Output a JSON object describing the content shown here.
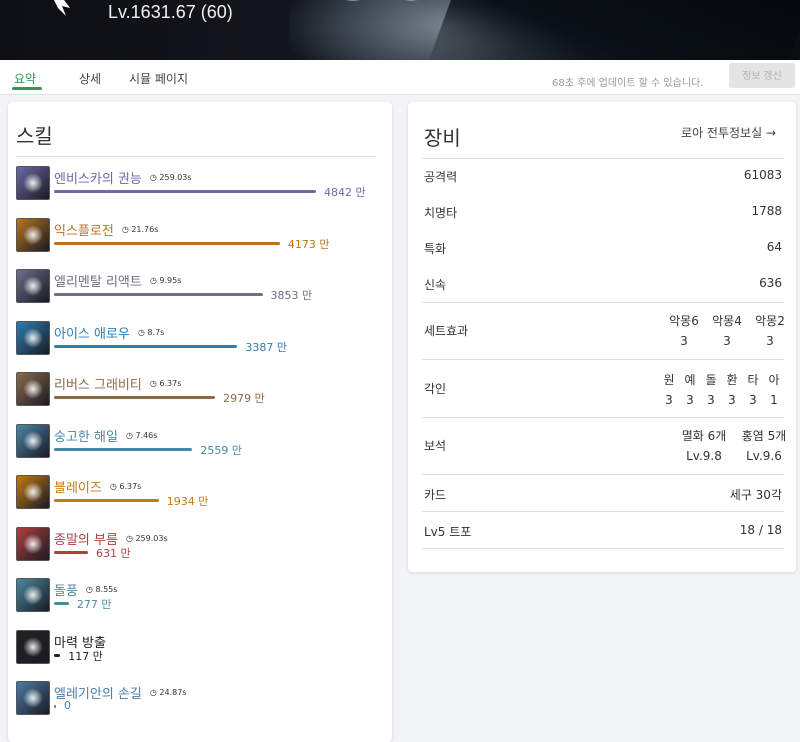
{
  "header": {
    "level_text": "Lv.1631.67 (60)"
  },
  "tabs": [
    {
      "label": "요약",
      "active": true
    },
    {
      "label": "상세",
      "active": false
    },
    {
      "label": "시뮬 페이지",
      "active": false
    }
  ],
  "update_note": "68초 후에 업데이트 할 수 있습니다.",
  "refresh_label": "정보 갱신",
  "skills": {
    "title": "스킬",
    "items": [
      {
        "name": "엔비스카의 권능",
        "cooldown": "259.03s",
        "damage": "4842 만",
        "bar_fraction": 1.0,
        "color": "#6d6aa8",
        "icon": "envisca-authority-icon"
      },
      {
        "name": "익스플로전",
        "cooldown": "21.76s",
        "damage": "4173 만",
        "bar_fraction": 0.862,
        "color": "#b8741c",
        "icon": "explosion-icon"
      },
      {
        "name": "엘리멘탈 리액트",
        "cooldown": "9.95s",
        "damage": "3853 만",
        "bar_fraction": 0.796,
        "color": "#6c6f87",
        "icon": "elemental-react-icon"
      },
      {
        "name": "아이스 애로우",
        "cooldown": "8.7s",
        "damage": "3387 만",
        "bar_fraction": 0.7,
        "color": "#2d7eb2",
        "icon": "ice-arrow-icon"
      },
      {
        "name": "리버스 그래비티",
        "cooldown": "6.37s",
        "damage": "2979 만",
        "bar_fraction": 0.615,
        "color": "#8b6a4a",
        "icon": "reverse-gravity-icon"
      },
      {
        "name": "숭고한 해일",
        "cooldown": "7.46s",
        "damage": "2559 만",
        "bar_fraction": 0.528,
        "color": "#4a86a8",
        "icon": "sublime-wave-icon"
      },
      {
        "name": "블레이즈",
        "cooldown": "6.37s",
        "damage": "1934 만",
        "bar_fraction": 0.4,
        "color": "#c47a10",
        "icon": "blaze-icon"
      },
      {
        "name": "종말의 부름",
        "cooldown": "259.03s",
        "damage": "631 만",
        "bar_fraction": 0.13,
        "color": "#b04040",
        "icon": "call-of-doom-icon"
      },
      {
        "name": "돌풍",
        "cooldown": "8.55s",
        "damage": "277 만",
        "bar_fraction": 0.057,
        "color": "#4a8aa0",
        "icon": "gust-icon"
      },
      {
        "name": "마력 방출",
        "cooldown": "",
        "damage": "117 만",
        "bar_fraction": 0.024,
        "color": "#222222",
        "icon": "mana-release-icon"
      },
      {
        "name": "엘레기안의 손길",
        "cooldown": "24.87s",
        "damage": "0",
        "bar_fraction": 0.0,
        "color": "#4a7ca8",
        "icon": "elegian-touch-icon"
      }
    ]
  },
  "equipment": {
    "title": "장비",
    "link_label": "로아 전투정보실 →",
    "stats": [
      {
        "label": "공격력",
        "value": "61083"
      },
      {
        "label": "치명타",
        "value": "1788"
      },
      {
        "label": "특화",
        "value": "64"
      },
      {
        "label": "신속",
        "value": "636"
      }
    ],
    "set_effect": {
      "label": "세트효과",
      "cols": [
        {
          "name": "악몽6",
          "value": "3"
        },
        {
          "name": "악몽4",
          "value": "3"
        },
        {
          "name": "악몽2",
          "value": "3"
        }
      ]
    },
    "engraving": {
      "label": "각인",
      "cols": [
        {
          "name": "원",
          "value": "3"
        },
        {
          "name": "예",
          "value": "3"
        },
        {
          "name": "돌",
          "value": "3"
        },
        {
          "name": "환",
          "value": "3"
        },
        {
          "name": "타",
          "value": "3"
        },
        {
          "name": "아",
          "value": "1"
        }
      ]
    },
    "gems": {
      "label": "보석",
      "cols": [
        {
          "name": "멸화 6개",
          "value": "Lv.9.8"
        },
        {
          "name": "홍염 5개",
          "value": "Lv.9.6"
        }
      ]
    },
    "card": {
      "label": "카드",
      "value": "세구 30각"
    },
    "trophy": {
      "label": "Lv5 트포",
      "value": "18 / 18"
    }
  }
}
